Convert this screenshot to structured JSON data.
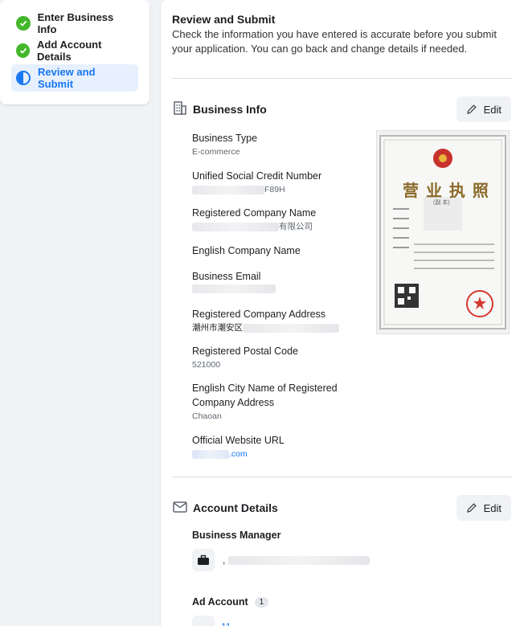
{
  "steps": [
    {
      "label": "Enter Business Info",
      "state": "complete"
    },
    {
      "label": "Add Account Details",
      "state": "complete"
    },
    {
      "label": "Review and Submit",
      "state": "current"
    }
  ],
  "header": {
    "title": "Review and Submit",
    "subtitle": "Check the information you have entered is accurate before you submit your application. You can go back and change details if needed."
  },
  "business_info": {
    "title": "Business Info",
    "edit_label": "Edit",
    "fields": {
      "business_type": {
        "label": "Business Type",
        "value": "E-commerce"
      },
      "credit_number": {
        "label": "Unified Social Credit Number",
        "value": "F89H"
      },
      "company_name": {
        "label": "Registered Company Name",
        "value": "有限公司"
      },
      "english_name": {
        "label": "English Company Name",
        "value": ""
      },
      "email": {
        "label": "Business Email",
        "value": ""
      },
      "address": {
        "label": "Registered Company Address",
        "value": "潮州市潮安区"
      },
      "postal": {
        "label": "Registered Postal Code",
        "value": "521000"
      },
      "english_city": {
        "label": "English City Name of Registered Company Address",
        "value": "Chaoan"
      },
      "website": {
        "label": "Official Website URL",
        "value": ".com"
      }
    },
    "license_image": {
      "title": "营 业 执 照",
      "subtitle": "(副 本)"
    }
  },
  "account_details": {
    "title": "Account Details",
    "edit_label": "Edit",
    "business_manager_label": "Business Manager",
    "business_manager_value": ",",
    "ad_account_label": "Ad Account",
    "ad_account_count": "1",
    "ad_account_id": "11"
  },
  "colors": {
    "accent": "#1877f2",
    "success": "#42b72a",
    "background": "#f0f2f5"
  },
  "icons": {
    "step_complete": "check-circle-icon",
    "step_current": "half-circle-icon",
    "business": "building-icon",
    "account": "envelope-briefcase-icon",
    "edit": "pencil-icon"
  }
}
